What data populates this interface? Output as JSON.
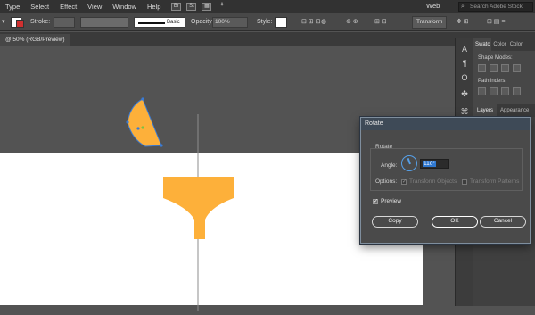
{
  "menubar": {
    "items": [
      "Type",
      "Select",
      "Effect",
      "View",
      "Window",
      "Help"
    ],
    "workspace": "Web",
    "stock_search_placeholder": "Search Adobe Stock"
  },
  "controlbar": {
    "stroke_label": "Stroke:",
    "brush_label": "Basic",
    "opacity_label": "Opacity:",
    "opacity_value": "100%",
    "style_label": "Style:",
    "transform_button": "Transform"
  },
  "document_tab": "@ 50% (RGB/Preview)",
  "right_panel": {
    "top_tabs": [
      "Swatc",
      "Color",
      "Color"
    ],
    "shape_modes_label": "Shape Modes:",
    "pathfinders_label": "Pathfinders:",
    "bottom_tabs": [
      "Layers",
      "Appearance"
    ]
  },
  "rotate_dialog": {
    "title": "Rotate",
    "group_label": "Rotate",
    "angle_label": "Angle:",
    "angle_value": "110°",
    "options_label": "Options:",
    "transform_objects_label": "Transform Objects",
    "transform_patterns_label": "Transform Patterns",
    "preview_label": "Preview",
    "copy_button": "Copy",
    "ok_button": "OK",
    "cancel_button": "Cancel"
  },
  "colors": {
    "shape_fill": "#fdb03a",
    "artboard": "#ffffff",
    "ui_dark": "#323232",
    "selection_blue": "#3a7bd5"
  }
}
